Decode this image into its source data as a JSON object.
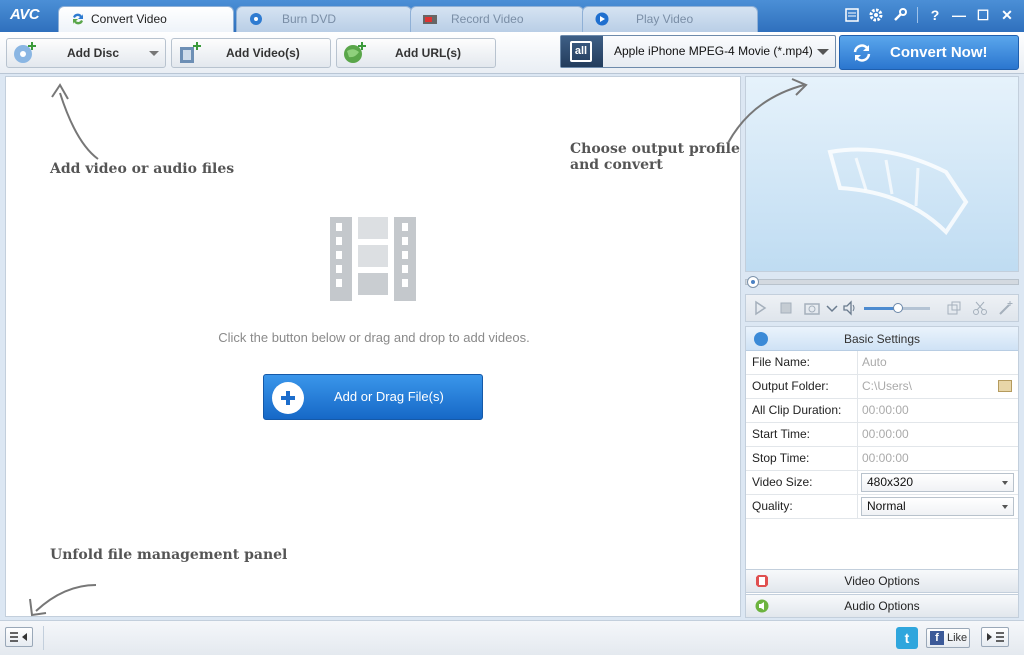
{
  "app": {
    "logo": "AVC"
  },
  "tabs": [
    {
      "label": "Convert Video",
      "active": true,
      "icon": "convert-icon"
    },
    {
      "label": "Burn DVD",
      "active": false,
      "icon": "disc-icon"
    },
    {
      "label": "Record Video",
      "active": false,
      "icon": "record-icon"
    },
    {
      "label": "Play Video",
      "active": false,
      "icon": "play-icon"
    }
  ],
  "window_controls": [
    "skin-icon",
    "gear-icon",
    "wrench-icon",
    "help-icon",
    "minimize-icon",
    "maximize-icon",
    "close-icon"
  ],
  "window_control_glyphs": {
    "help": "?",
    "minimize": "—",
    "maximize": "☐",
    "close": "✕"
  },
  "toolbar": {
    "add_disc": "Add Disc",
    "add_videos": "Add Video(s)",
    "add_url": "Add URL(s)",
    "profile_icon_text": "all",
    "profile": "Apple iPhone MPEG-4 Movie (*.mp4)",
    "convert": "Convert Now!"
  },
  "hints": {
    "add_files": "Add video or audio files",
    "output_profile": "Choose output profile and convert",
    "unfold_panel": "Unfold file management panel"
  },
  "main": {
    "drop_message": "Click the button below or drag and drop to add videos.",
    "add_button": "Add or Drag File(s)"
  },
  "settings": {
    "header": "Basic Settings",
    "rows": [
      {
        "key": "File Name:",
        "value": "Auto"
      },
      {
        "key": "Output Folder:",
        "value": "C:\\Users\\"
      },
      {
        "key": "All Clip Duration:",
        "value": "00:00:00"
      },
      {
        "key": "Start Time:",
        "value": "00:00:00"
      },
      {
        "key": "Stop Time:",
        "value": "00:00:00"
      },
      {
        "key": "Video Size:",
        "value": "480x320"
      },
      {
        "key": "Quality:",
        "value": "Normal"
      }
    ]
  },
  "options": {
    "video": "Video Options",
    "audio": "Audio Options"
  },
  "social": {
    "twitter": "t",
    "facebook": "f",
    "like": "Like"
  },
  "colors": {
    "accent": "#2b76cf",
    "titlebar": "#3a7fcc",
    "twitter": "#2fa6dd",
    "facebook": "#3b5998"
  }
}
